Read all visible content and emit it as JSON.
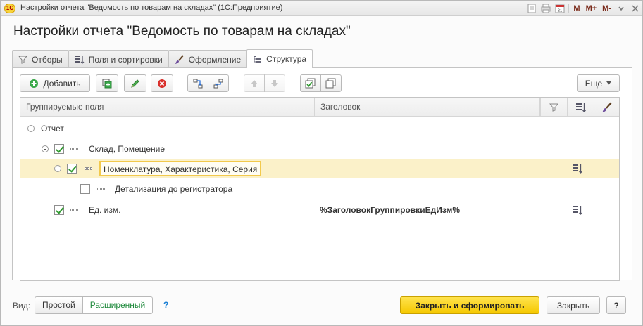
{
  "window": {
    "app_logo": "1С",
    "title": "Настройки отчета \"Ведомость по товарам на складах\"  (1С:Предприятие)",
    "controls": [
      "M",
      "M+",
      "M-"
    ]
  },
  "page_title": "Настройки отчета \"Ведомость по товарам на складах\"",
  "tabs": [
    {
      "label": "Отборы",
      "icon": "filter-icon"
    },
    {
      "label": "Поля и сортировки",
      "icon": "fields-sort-icon"
    },
    {
      "label": "Оформление",
      "icon": "brush-icon"
    },
    {
      "label": "Структура",
      "icon": "structure-icon",
      "active": true
    }
  ],
  "toolbar": {
    "add_label": "Добавить",
    "more_label": "Еще"
  },
  "grid": {
    "columns": {
      "fields": "Группируемые поля",
      "header": "Заголовок"
    },
    "rows": [
      {
        "label": "Отчет",
        "header": ""
      },
      {
        "label": "Склад, Помещение",
        "header": ""
      },
      {
        "label": "Номенклатура, Характеристика, Серия",
        "header": ""
      },
      {
        "label": "Детализация до регистратора",
        "header": ""
      },
      {
        "label": "Ед. изм.",
        "header": "%ЗаголовокГруппировкиЕдИзм%"
      }
    ]
  },
  "footer": {
    "view_label": "Вид:",
    "simple_label": "Простой",
    "advanced_label": "Расширенный",
    "help_label": "?",
    "generate_label": "Закрыть и сформировать",
    "close_label": "Закрыть",
    "help_button_label": "?"
  },
  "colors": {
    "accent_green": "#1f8a3c",
    "selection": "#fbf1c9",
    "primary_button": "#f5c800"
  }
}
